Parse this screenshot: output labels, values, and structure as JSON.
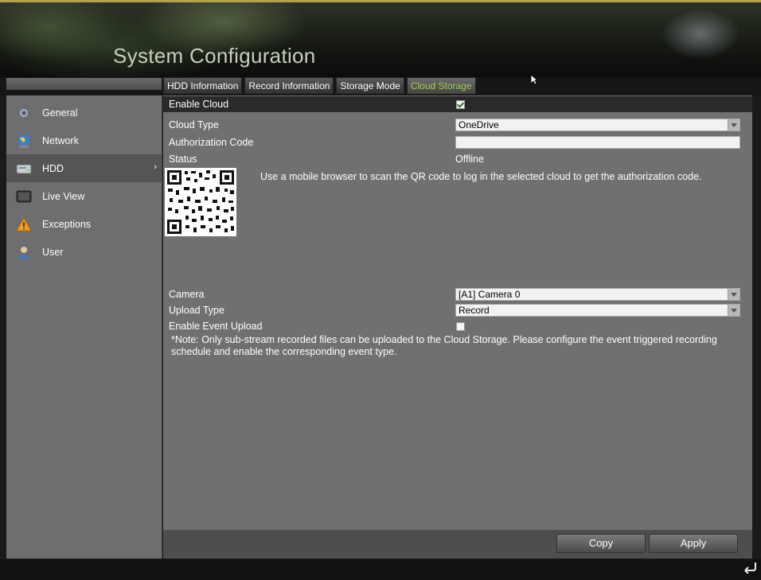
{
  "header": {
    "title": "System Configuration"
  },
  "tabs": [
    {
      "label": "HDD Information"
    },
    {
      "label": "Record Information"
    },
    {
      "label": "Storage Mode"
    },
    {
      "label": "Cloud Storage"
    }
  ],
  "sidebar": {
    "items": [
      {
        "label": "General",
        "icon": "gear-icon"
      },
      {
        "label": "Network",
        "icon": "globe-icon"
      },
      {
        "label": "HDD",
        "icon": "hdd-icon",
        "selected": true,
        "chevron": "›"
      },
      {
        "label": "Live View",
        "icon": "monitor-icon"
      },
      {
        "label": "Exceptions",
        "icon": "warning-icon"
      },
      {
        "label": "User",
        "icon": "user-icon"
      }
    ]
  },
  "form": {
    "enable_cloud": {
      "label": "Enable Cloud",
      "checked": true
    },
    "cloud_type": {
      "label": "Cloud Type",
      "value": "OneDrive"
    },
    "authorization_code": {
      "label": "Authorization Code",
      "value": ""
    },
    "status": {
      "label": "Status",
      "value": "Offline"
    },
    "qr_hint": "Use a mobile browser to scan the QR code to log in the selected cloud to get the authorization code.",
    "camera": {
      "label": "Camera",
      "value": "[A1] Camera 0"
    },
    "upload_type": {
      "label": "Upload Type",
      "value": "Record"
    },
    "enable_event_upload": {
      "label": "Enable Event Upload",
      "checked": false
    },
    "note": "*Note: Only sub-stream recorded files can be uploaded to the Cloud Storage. Please configure the event triggered recording schedule and enable the corresponding event type."
  },
  "buttons": {
    "copy": "Copy",
    "apply": "Apply"
  },
  "icons": {
    "back": "back-arrow-icon",
    "cursor": "mouse-cursor-icon"
  },
  "colors": {
    "active_tab": "#9ecf4d",
    "panel": "#707070",
    "sidebar": "#6e6e6e"
  }
}
